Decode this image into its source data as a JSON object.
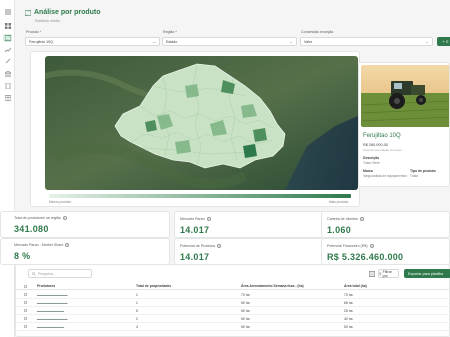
{
  "sidebar": {
    "items": [
      {
        "icon": "menu-icon"
      },
      {
        "icon": "grid-icon"
      },
      {
        "icon": "map-icon",
        "active": true
      },
      {
        "icon": "chart-icon"
      },
      {
        "icon": "tools-icon"
      },
      {
        "icon": "bank-icon"
      },
      {
        "icon": "document-icon"
      },
      {
        "icon": "table-icon"
      }
    ]
  },
  "header": {
    "title": "Análise por produto",
    "subtitle": "Subtítulo médio"
  },
  "filters": {
    "produto": {
      "label": "Produto *",
      "value": "Ferrujênio 10Q"
    },
    "regiao": {
      "label": "Região *",
      "value": "Estado"
    },
    "concessao": {
      "label": "Concessão exceção",
      "value": "Valor"
    },
    "apply_label": "+ 0"
  },
  "map": {
    "legend_low": "Menos produtor",
    "legend_high": "Mais produtor"
  },
  "product": {
    "name": "Ferujiltao 10Q",
    "price": "R$ 260.000,00",
    "price_note": "Cota de exportação ou preço",
    "fields": [
      {
        "key": "Descrição",
        "value": "Trator Série"
      },
      {
        "key": "Marca",
        "value": "Vanguardista de equipamentos"
      },
      {
        "key": "Tipo de produto",
        "value": "Trator"
      }
    ]
  },
  "stats": [
    {
      "label": "Total de produtores na região",
      "value": "341.080"
    },
    {
      "label": "Mercado Paran",
      "value": "14.017"
    },
    {
      "label": "Carteira de clientes",
      "value": "1.060"
    },
    {
      "label": "Mercado Paran - Market Share",
      "value": "8 %"
    },
    {
      "label": "Potencial de Produtos",
      "value": "14.017"
    },
    {
      "label": "Potencial Financeiro (R$)",
      "value": "R$ 5.326.460.000"
    }
  ],
  "table": {
    "search_placeholder": "Pesquisa...",
    "filter_label": "Filtrar por",
    "export_label": "Exportar para planilha",
    "columns": [
      "Produtores",
      "Total de propriedades",
      "Área Arrendamento Semana fosa - (ha)",
      "Área total (ha)"
    ],
    "rows": [
      [
        "▬▬▬▬▬▬▬▬▬",
        "1",
        "70 ha",
        "70 ha"
      ],
      [
        "▬▬▬▬▬▬▬▬▬",
        "1",
        "50 ha",
        "65 ha"
      ],
      [
        "▬▬▬▬▬▬▬▬",
        "5",
        "50 ha",
        "25 ha"
      ],
      [
        "▬▬▬▬▬▬▬▬▬",
        "2",
        "50 ha",
        "40 ha"
      ],
      [
        "▬▬▬▬▬▬▬▬",
        "4",
        "50 ha",
        "50 ha"
      ]
    ]
  }
}
